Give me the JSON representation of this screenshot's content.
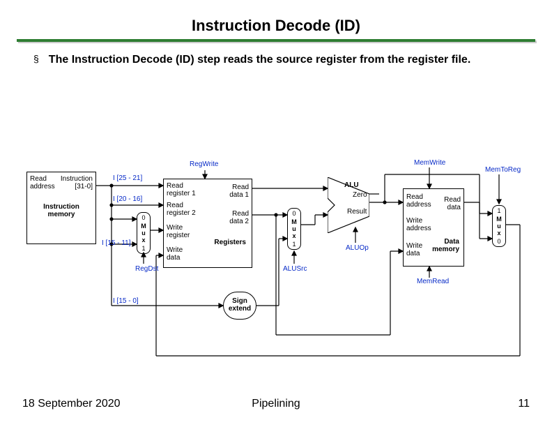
{
  "title": "Instruction Decode (ID)",
  "bullet": "The Instruction Decode (ID) step reads the source register from the register file.",
  "signals": {
    "regwrite": "RegWrite",
    "memwrite": "MemWrite",
    "memtoreg": "MemToReg",
    "regdst": "RegDst",
    "alusrc": "ALUSrc",
    "aluop": "ALUOp",
    "memread": "MemRead"
  },
  "bits": {
    "i25_21": "I [25 - 21]",
    "i20_16": "I [20 - 16]",
    "i15_11": "I [15 - 11]",
    "i15_0": "I [15 - 0]"
  },
  "im": {
    "l1": "Read",
    "l2": "address",
    "r1": "Instruction",
    "r2": "[31-0]",
    "name": "Instruction\nmemory"
  },
  "rf": {
    "rr1": "Read\nregister 1",
    "rr2": "Read\nregister 2",
    "wr": "Write\nregister",
    "wd": "Write\ndata",
    "rd1": "Read\ndata 1",
    "rd2": "Read\ndata 2",
    "name": "Registers"
  },
  "alu": {
    "name": "ALU",
    "zero": "Zero",
    "result": "Result"
  },
  "mem": {
    "ra": "Read\naddress",
    "wa": "Write\naddress",
    "wd": "Write\ndata",
    "rd": "Read\ndata",
    "name": "Data\nmemory"
  },
  "mux": {
    "mux": "M\nu\nx",
    "zero": "0",
    "one": "1"
  },
  "sign": "Sign\nextend",
  "footer": {
    "date": "18 September 2020",
    "center": "Pipelining",
    "page": "11"
  }
}
